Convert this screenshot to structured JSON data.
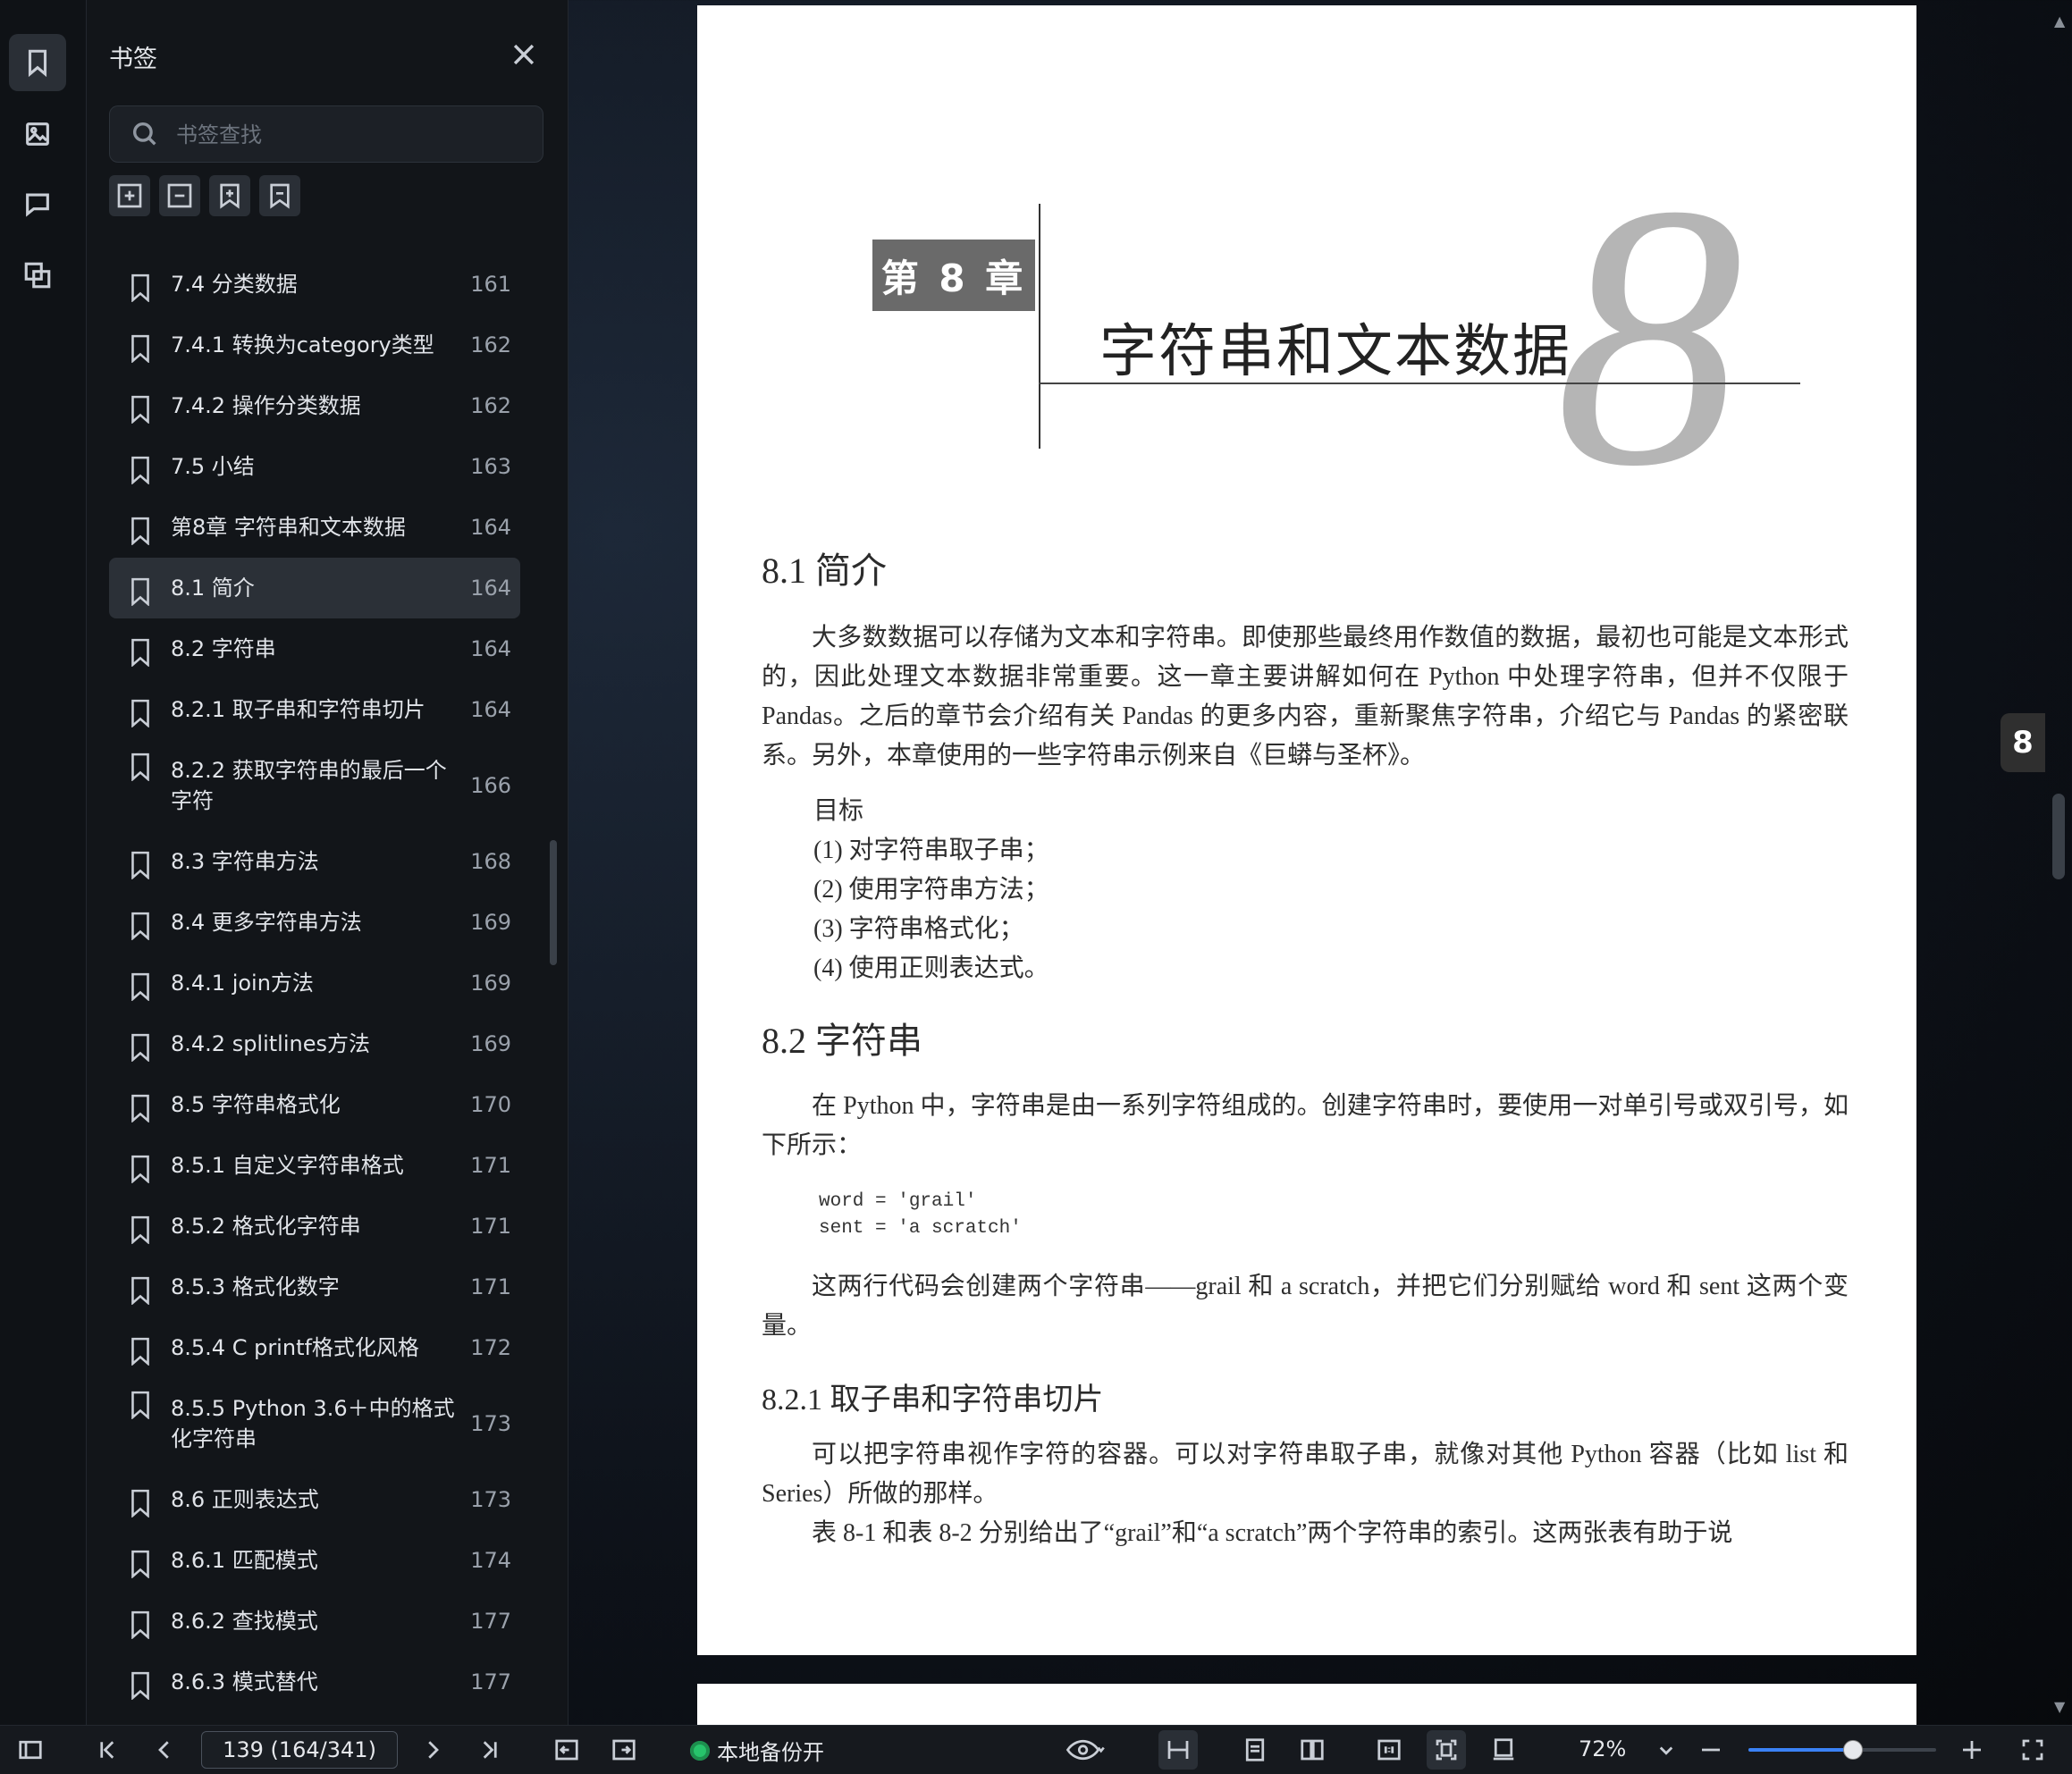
{
  "sidebar_panel": {
    "title": "书签",
    "search_placeholder": "书签查找",
    "bookmarks": [
      {
        "label": "7.4  分类数据",
        "page": "161"
      },
      {
        "label": "7.4.1  转换为category类型",
        "page": "162"
      },
      {
        "label": "7.4.2  操作分类数据",
        "page": "162"
      },
      {
        "label": "7.5  小结",
        "page": "163"
      },
      {
        "label": "第8章  字符串和文本数据",
        "page": "164"
      },
      {
        "label": "8.1  简介",
        "page": "164",
        "selected": true
      },
      {
        "label": "8.2  字符串",
        "page": "164"
      },
      {
        "label": "8.2.1  取子串和字符串切片",
        "page": "164"
      },
      {
        "label": "8.2.2  获取字符串的最后一个字符",
        "page": "166",
        "tall": true
      },
      {
        "label": "8.3  字符串方法",
        "page": "168"
      },
      {
        "label": "8.4  更多字符串方法",
        "page": "169"
      },
      {
        "label": "8.4.1  join方法",
        "page": "169"
      },
      {
        "label": "8.4.2  splitlines方法",
        "page": "169"
      },
      {
        "label": "8.5  字符串格式化",
        "page": "170"
      },
      {
        "label": "8.5.1  自定义字符串格式",
        "page": "171"
      },
      {
        "label": "8.5.2  格式化字符串",
        "page": "171"
      },
      {
        "label": "8.5.3  格式化数字",
        "page": "171"
      },
      {
        "label": "8.5.4  C printf格式化风格",
        "page": "172"
      },
      {
        "label": "8.5.5  Python 3.6＋中的格式化字符串",
        "page": "173",
        "tall": true
      },
      {
        "label": "8.6  正则表达式",
        "page": "173"
      },
      {
        "label": "8.6.1  匹配模式",
        "page": "174"
      },
      {
        "label": "8.6.2  查找模式",
        "page": "177"
      },
      {
        "label": "8.6.3  模式替代",
        "page": "177"
      }
    ]
  },
  "document": {
    "chapter_label": "第 8 章",
    "chapter_title": "字符串和文本数据",
    "chapter_number": "8",
    "side_tab": "8",
    "s81_heading": "8.1    简介",
    "s81_para": "大多数数据可以存储为文本和字符串。即使那些最终用作数值的数据，最初也可能是文本形式的，因此处理文本数据非常重要。这一章主要讲解如何在 Python 中处理字符串，但并不仅限于 Pandas。之后的章节会介绍有关 Pandas 的更多内容，重新聚焦字符串，介绍它与 Pandas 的紧密联系。另外，本章使用的一些字符串示例来自《巨蟒与圣杯》。",
    "goals_title": "目标",
    "goals": [
      "(1) 对字符串取子串；",
      "(2) 使用字符串方法；",
      "(3) 字符串格式化；",
      "(4) 使用正则表达式。"
    ],
    "s82_heading": "8.2    字符串",
    "s82_para": "在 Python 中，字符串是由一系列字符组成的。创建字符串时，要使用一对单引号或双引号，如下所示：",
    "code": "word = 'grail'\nsent = 'a scratch'",
    "s82_para2": "这两行代码会创建两个字符串——grail 和 a scratch，并把它们分别赋给 word 和 sent 这两个变量。",
    "s821_heading": "8.2.1    取子串和字符串切片",
    "s821_para": "可以把字符串视作字符的容器。可以对字符串取子串，就像对其他 Python 容器（比如 list 和 Series）所做的那样。",
    "s821_para2": "表 8-1 和表 8-2 分别给出了“grail”和“a scratch”两个字符串的索引。这两张表有助于说"
  },
  "toolbar": {
    "page_indicator": "139 (164/341)",
    "backup_status": "本地备份开",
    "zoom": "72%",
    "zoom_fraction": 0.55,
    "status_color": "#27c46b"
  },
  "icons": [
    "bookmark-icon",
    "image-icon",
    "comment-icon",
    "thumbnail-icon",
    "close-icon",
    "search-icon"
  ]
}
